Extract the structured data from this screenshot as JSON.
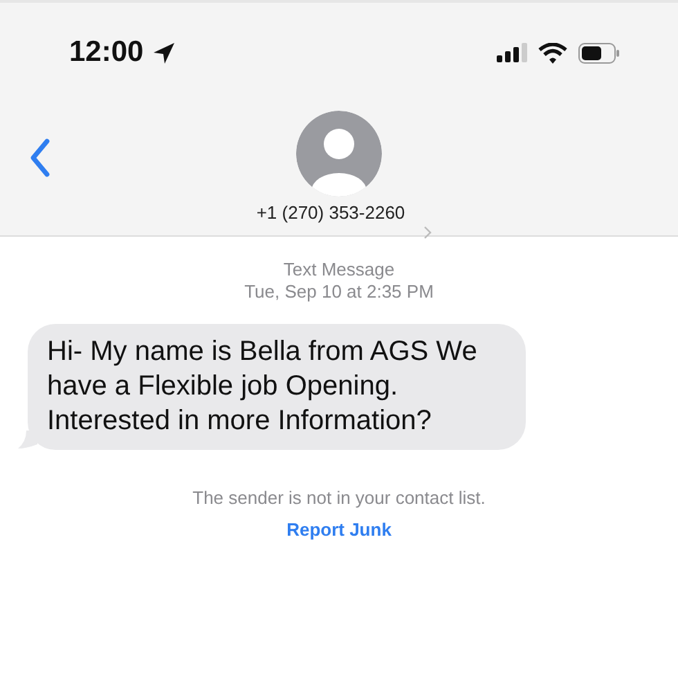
{
  "status_bar": {
    "time": "12:00"
  },
  "header": {
    "contact": "+1 (270) 353-2260"
  },
  "thread": {
    "service": "Text Message",
    "timestamp": "Tue, Sep 10 at 2:35 PM",
    "messages": [
      {
        "text": "Hi- My name is Bella from AGS We have a Flexible job Opening. Interested in more Information?"
      }
    ],
    "notice": "The sender is not in your contact list.",
    "link": "Report Junk"
  }
}
